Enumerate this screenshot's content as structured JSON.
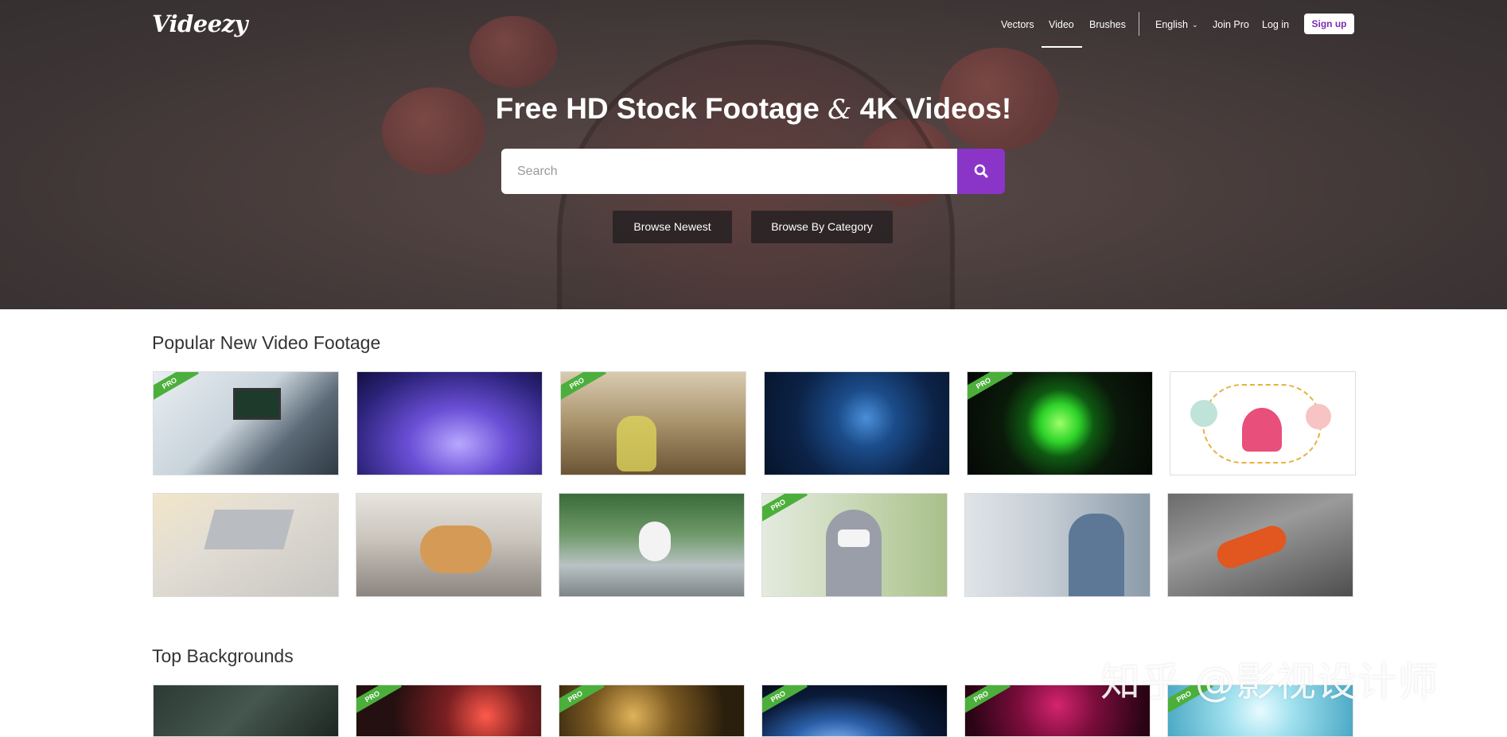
{
  "header": {
    "logo": "Videezy",
    "nav": {
      "vectors": "Vectors",
      "video": "Video",
      "brushes": "Brushes",
      "language": "English",
      "join_pro": "Join Pro",
      "login": "Log in",
      "signup": "Sign up"
    }
  },
  "hero": {
    "title_part1": "Free HD Stock Footage",
    "title_amp": "&",
    "title_part2": "4K Videos!",
    "search_placeholder": "Search",
    "browse_newest": "Browse Newest",
    "browse_category": "Browse By Category"
  },
  "sections": {
    "popular": {
      "title": "Popular New Video Footage",
      "badge": "PRO",
      "items": [
        {
          "subject": "scientist at microscope",
          "pro": true
        },
        {
          "subject": "lab vials purple light",
          "pro": false
        },
        {
          "subject": "laboratory flask",
          "pro": true
        },
        {
          "subject": "blue virus particles",
          "pro": false
        },
        {
          "subject": "green glowing cell",
          "pro": true
        },
        {
          "subject": "online shopping illustration",
          "pro": false
        },
        {
          "subject": "typing on laptop",
          "pro": false
        },
        {
          "subject": "couple on sofa",
          "pro": false
        },
        {
          "subject": "woman working at table",
          "pro": false
        },
        {
          "subject": "woman in mask thumbs up",
          "pro": true
        },
        {
          "subject": "stressed man at laptop",
          "pro": false
        },
        {
          "subject": "orange glove cleaning",
          "pro": false
        }
      ]
    },
    "backgrounds": {
      "title": "Top Backgrounds",
      "badge": "PRO",
      "items": [
        {
          "subject": "circuit board",
          "pro": false
        },
        {
          "subject": "red particles",
          "pro": true
        },
        {
          "subject": "golden bokeh",
          "pro": true
        },
        {
          "subject": "earth from space",
          "pro": true
        },
        {
          "subject": "magenta abstract",
          "pro": true
        },
        {
          "subject": "light blue glow",
          "pro": true
        }
      ]
    }
  },
  "watermark": "知乎 @影视设计师",
  "colors": {
    "accent": "#8a35c8",
    "signup_text": "#7b2bb5",
    "pro_badge": "#4caf3c"
  },
  "icons": {
    "search": "search-icon",
    "language_dropdown": "chevron-down-icon"
  }
}
